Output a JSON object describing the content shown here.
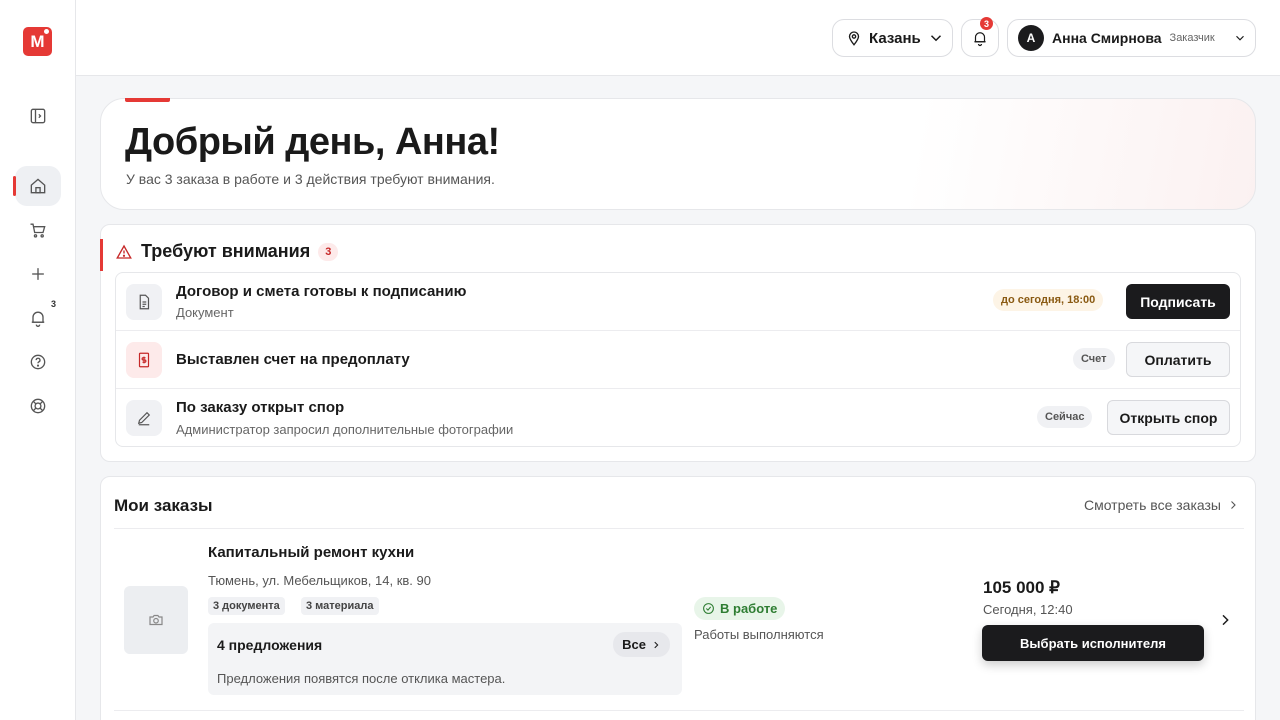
{
  "brand": {
    "logo_letter": "М"
  },
  "sidebar": {
    "notif_badge": "3",
    "items": [
      {
        "name": "sidebar-toggle",
        "icon": "panel-icon"
      },
      {
        "name": "sidebar-item-home",
        "icon": "home-icon"
      },
      {
        "name": "sidebar-item-cart",
        "icon": "cart-icon"
      },
      {
        "name": "sidebar-item-create",
        "icon": "plus-icon"
      },
      {
        "name": "sidebar-item-notifications",
        "icon": "bell-icon"
      },
      {
        "name": "sidebar-item-help",
        "icon": "help-icon"
      },
      {
        "name": "sidebar-item-support",
        "icon": "lifebuoy-icon"
      }
    ]
  },
  "topbar": {
    "city": "Казань",
    "notifications_count": "3",
    "user": {
      "initial": "А",
      "name": "Анна Смирнова",
      "role": "Заказчик"
    }
  },
  "hero": {
    "title": "Добрый день, Анна!",
    "subtitle": "У вас 3 заказа в работе и 3 действия требуют внимания."
  },
  "attention": {
    "title": "Требуют внимания",
    "count": "3",
    "items": [
      {
        "title": "Договор и смета готовы к подписанию",
        "subtitle": "Документ",
        "tag": "до сегодня, 18:00",
        "action": "Подписать"
      },
      {
        "title": "Выставлен счет на предоплату",
        "subtitle": "",
        "tag": "Счет",
        "action": "Оплатить"
      },
      {
        "title": "По заказу открыт спор",
        "subtitle": "Администратор запросил дополнительные фотографии",
        "tag": "Сейчас",
        "action": "Открыть спор"
      }
    ]
  },
  "orders": {
    "title": "Мои заказы",
    "see_all": "Смотреть все заказы",
    "items": [
      {
        "title": "Капитальный ремонт кухни",
        "address": "Тюмень, ул. Мебельщиков, 14, кв. 90",
        "chips": [
          "3 документа",
          "3 материала"
        ],
        "offers_title": "4 предложения",
        "offers_all": "Все",
        "offers_note": "Предложения появятся после отклика мастера.",
        "status": "В работе",
        "status_note": "Работы выполняются",
        "price": "105 000 ₽",
        "date": "Сегодня, 12:40",
        "action": "Выбрать исполнителя"
      }
    ]
  },
  "colors": {
    "accent": "#e53935",
    "dark": "#1b1b1d",
    "success": "#2e7d32"
  }
}
